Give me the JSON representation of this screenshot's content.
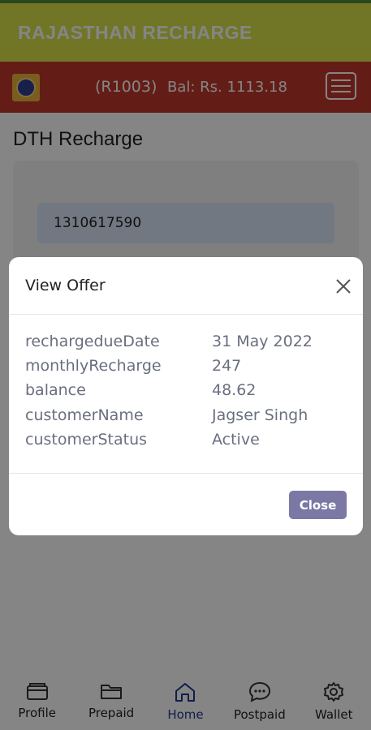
{
  "app": {
    "title": "RAJASTHAN RECHARGE"
  },
  "header": {
    "user_code": "(R1003)",
    "balance": "Bal: Rs. 1113.18"
  },
  "page": {
    "title": "DTH Recharge",
    "number_value": "1310617590"
  },
  "modal": {
    "title": "View Offer",
    "rows": [
      {
        "key": "rechargedueDate",
        "value": "31 May 2022"
      },
      {
        "key": "monthlyRecharge",
        "value": "247"
      },
      {
        "key": "balance",
        "value": "48.62"
      },
      {
        "key": "customerName",
        "value": "Jagser Singh"
      },
      {
        "key": "customerStatus",
        "value": "Active"
      }
    ],
    "close_label": "Close"
  },
  "nav": {
    "items": [
      {
        "label": "Profile",
        "icon": "wallet-icon"
      },
      {
        "label": "Prepaid",
        "icon": "folder-icon"
      },
      {
        "label": "Home",
        "icon": "home-icon"
      },
      {
        "label": "Postpaid",
        "icon": "chat-icon"
      },
      {
        "label": "Wallet",
        "icon": "gear-icon"
      }
    ],
    "active": "Home"
  },
  "colors": {
    "appbar": "#d6e24a",
    "subheader": "#c0392b",
    "button": "#7c78a6",
    "nav_active": "#1e3a8a"
  }
}
